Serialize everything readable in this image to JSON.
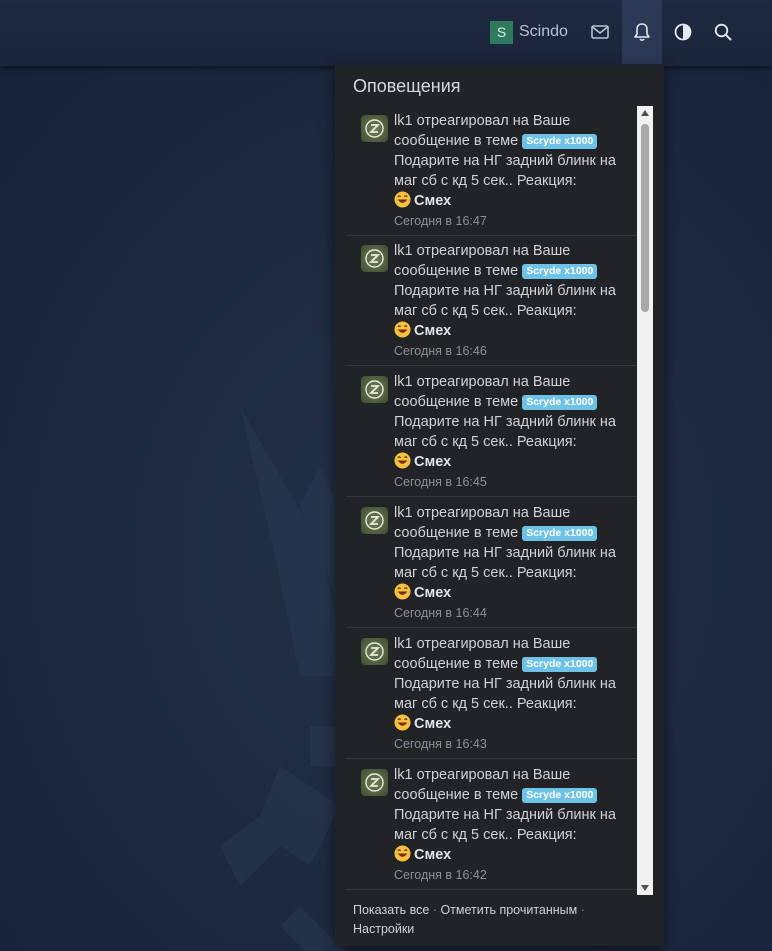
{
  "header": {
    "user": {
      "avatar_letter": "S",
      "name": "Scindo",
      "avatar_color": "#2f7a5e"
    },
    "icons": [
      "mail-icon",
      "bell-icon",
      "contrast-icon",
      "search-icon"
    ]
  },
  "notifications": {
    "title": "Оповещения",
    "items": [
      {
        "user": "lk1",
        "action": "отреагировал на Ваше сообщение в теме",
        "tag": "Scryde x1000",
        "thread": "Подарите на НГ задний блинк на маг сб с кд 5 сек.",
        "reaction_label": ". Реакция:",
        "reaction": "Смех",
        "time": "Сегодня в 16:47"
      },
      {
        "user": "lk1",
        "action": "отреагировал на Ваше сообщение в теме",
        "tag": "Scryde x1000",
        "thread": "Подарите на НГ задний блинк на маг сб с кд 5 сек.",
        "reaction_label": ". Реакция:",
        "reaction": "Смех",
        "time": "Сегодня в 16:46"
      },
      {
        "user": "lk1",
        "action": "отреагировал на Ваше сообщение в теме",
        "tag": "Scryde x1000",
        "thread": "Подарите на НГ задний блинк на маг сб с кд 5 сек.",
        "reaction_label": ". Реакция:",
        "reaction": "Смех",
        "time": "Сегодня в 16:45"
      },
      {
        "user": "lk1",
        "action": "отреагировал на Ваше сообщение в теме",
        "tag": "Scryde x1000",
        "thread": "Подарите на НГ задний блинк на маг сб с кд 5 сек.",
        "reaction_label": ". Реакция:",
        "reaction": "Смех",
        "time": "Сегодня в 16:44"
      },
      {
        "user": "lk1",
        "action": "отреагировал на Ваше сообщение в теме",
        "tag": "Scryde x1000",
        "thread": "Подарите на НГ задний блинк на маг сб с кд 5 сек.",
        "reaction_label": ". Реакция:",
        "reaction": "Смех",
        "time": "Сегодня в 16:43"
      },
      {
        "user": "lk1",
        "action": "отреагировал на Ваше сообщение в теме",
        "tag": "Scryde x1000",
        "thread": "Подарите на НГ задний блинк на маг сб с кд 5 сек.",
        "reaction_label": ". Реакция:",
        "reaction": "Смех",
        "time": "Сегодня в 16:42"
      }
    ],
    "footer": {
      "show_all": "Показать все",
      "mark_read": "Отметить прочитанным",
      "settings": "Настройки",
      "separator": "·"
    }
  },
  "colors": {
    "tag_bg": "#6dc2e6",
    "popup_bg": "#222327",
    "header_bg": "#1e2942",
    "active_icon_bg": "#2b3856"
  }
}
